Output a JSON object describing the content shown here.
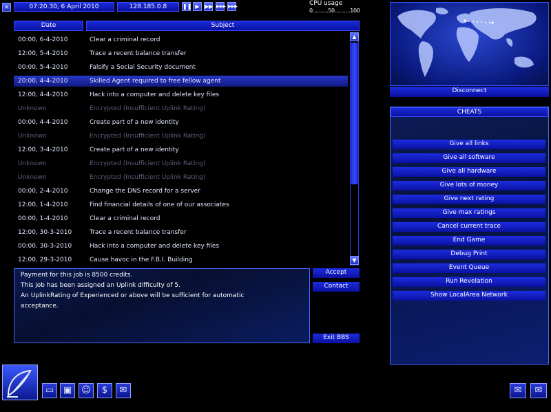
{
  "topbar": {
    "datetime": "07:20.30, 6 April 2010",
    "ip": "128.185.0.8",
    "cpu_label": "CPU usage",
    "cpu_scale": "0..........50..........100",
    "speed_buttons": [
      "pause-icon",
      "play-icon",
      "fast-icon",
      "faster-icon",
      "fastest-icon"
    ]
  },
  "bbs": {
    "col_date": "Date",
    "col_subject": "Subject",
    "rows": [
      {
        "date": "00:00, 6-4-2010",
        "subject": "Clear a criminal record",
        "locked": false,
        "selected": false
      },
      {
        "date": "12:00, 5-4-2010",
        "subject": "Trace a recent balance transfer",
        "locked": false,
        "selected": false
      },
      {
        "date": "00:00, 5-4-2010",
        "subject": "Falsify a Social Security document",
        "locked": false,
        "selected": false
      },
      {
        "date": "20:00, 4-4-2010",
        "subject": "Skilled Agent required to free fellow agent",
        "locked": false,
        "selected": true
      },
      {
        "date": "12:00, 4-4-2010",
        "subject": "Hack into a computer and delete key files",
        "locked": false,
        "selected": false
      },
      {
        "date": "Unknown",
        "subject": "Encrypted (Insufficient Uplink Rating)",
        "locked": true,
        "selected": false
      },
      {
        "date": "00:00, 4-4-2010",
        "subject": "Create part of a new identity",
        "locked": false,
        "selected": false
      },
      {
        "date": "Unknown",
        "subject": "Encrypted (Insufficient Uplink Rating)",
        "locked": true,
        "selected": false
      },
      {
        "date": "12:00, 3-4-2010",
        "subject": "Create part of a new identity",
        "locked": false,
        "selected": false
      },
      {
        "date": "Unknown",
        "subject": "Encrypted (Insufficient Uplink Rating)",
        "locked": true,
        "selected": false
      },
      {
        "date": "Unknown",
        "subject": "Encrypted (Insufficient Uplink Rating)",
        "locked": true,
        "selected": false
      },
      {
        "date": "00:00, 2-4-2010",
        "subject": "Change the DNS record for a server",
        "locked": false,
        "selected": false
      },
      {
        "date": "12:00, 1-4-2010",
        "subject": "Find financial details of one of our associates",
        "locked": false,
        "selected": false
      },
      {
        "date": "00:00, 1-4-2010",
        "subject": "Clear a criminal record",
        "locked": false,
        "selected": false
      },
      {
        "date": "12:00, 30-3-2010",
        "subject": "Trace a recent balance transfer",
        "locked": false,
        "selected": false
      },
      {
        "date": "00:00, 30-3-2010",
        "subject": "Hack into a computer and delete key files",
        "locked": false,
        "selected": false
      },
      {
        "date": "12:00, 29-3-2010",
        "subject": "Cause havoc in the F.B.I. Building",
        "locked": false,
        "selected": false
      }
    ],
    "details": [
      "Payment for this job is 8500 credits.",
      "This job has been assigned an Uplink difficulty of 5.",
      "An UplinkRating of Experienced or above will be sufficient for automatic",
      "acceptance."
    ],
    "accept_label": "Accept",
    "contact_label": "Contact",
    "exit_label": "Exit BBS"
  },
  "map": {
    "disconnect_label": "Disconnect"
  },
  "cheats": {
    "title": "CHEATS",
    "items": [
      "Give all links",
      "Give all software",
      "Give all hardware",
      "Give lots of money",
      "Give next rating",
      "Give max ratings",
      "Cancel current trace",
      "End Game",
      "Debug Print",
      "Event Queue",
      "Run Revelation",
      "Show LocalArea Network"
    ]
  },
  "taskbar": {
    "icons": [
      "monitor-icon",
      "disk-icon",
      "people-icon",
      "dollar-icon",
      "mail-open-icon"
    ],
    "right_icons": [
      "mail-icon",
      "mail-icon"
    ]
  }
}
